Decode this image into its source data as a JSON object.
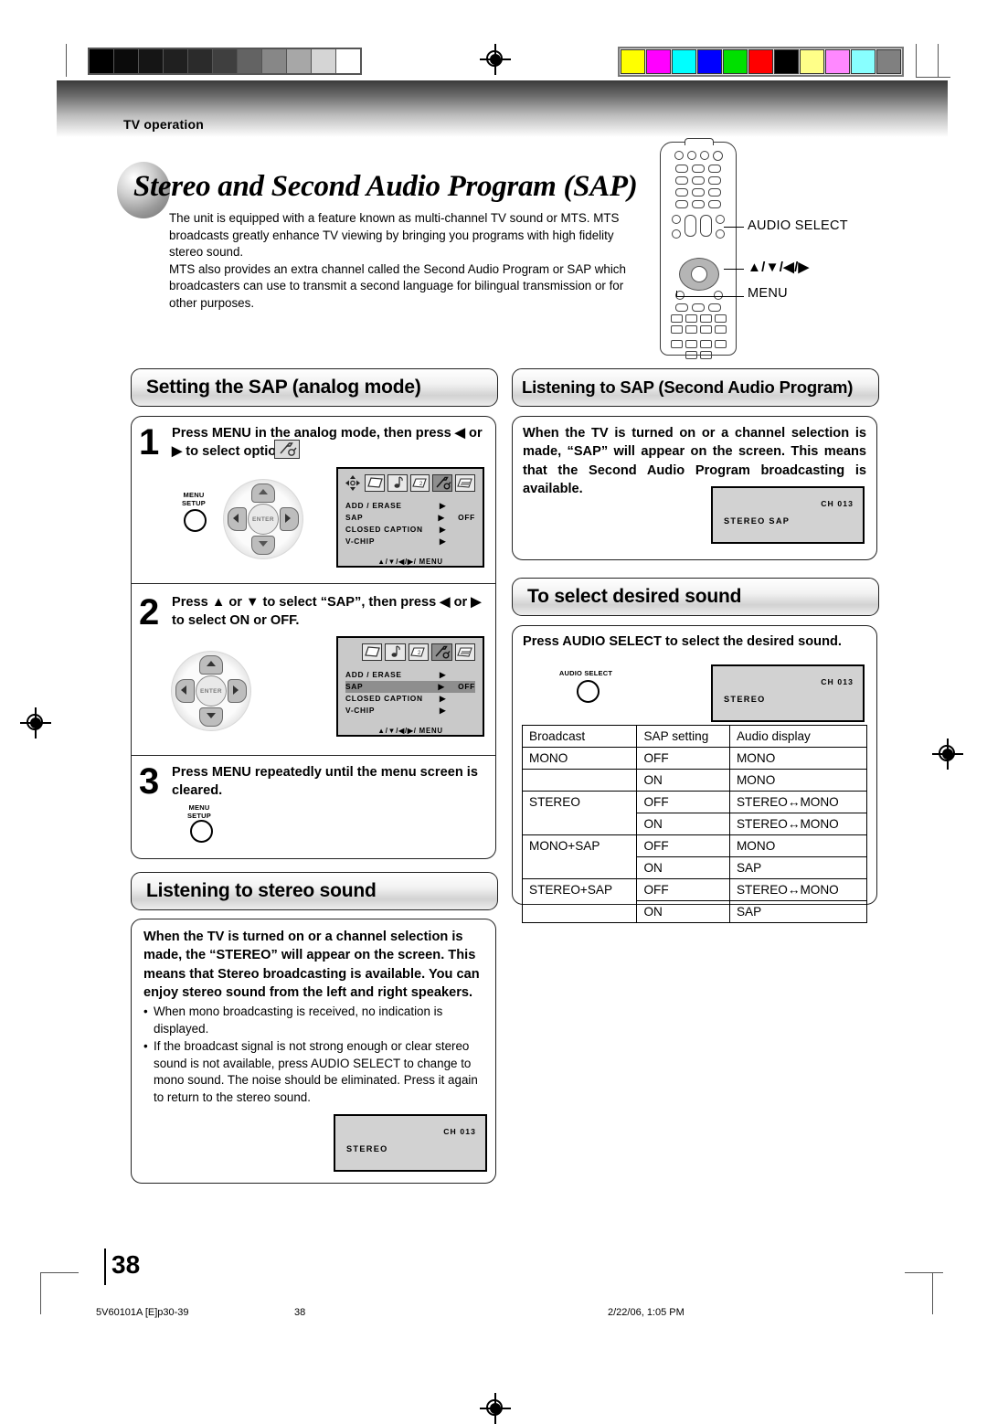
{
  "header": {
    "section_label": "TV operation"
  },
  "title": "Stereo and Second Audio Program (SAP)",
  "intro": "The unit is equipped with a feature known as multi-channel TV sound or MTS. MTS broadcasts greatly enhance TV viewing by bringing you programs with high fidelity stereo sound.\nMTS also provides an extra channel called the Second Audio Program or SAP which broadcasters can use to transmit a second language for bilingual transmission or for other purposes.",
  "remote_callouts": {
    "audio_select": "AUDIO SELECT",
    "arrows": "▲/▼/◀/▶",
    "menu": "MENU"
  },
  "sections": {
    "setting_sap": {
      "heading": "Setting the SAP (analog mode)",
      "steps": [
        {
          "num": "1",
          "text": "Press MENU in the analog mode, then press ◀ or ▶ to select         option."
        },
        {
          "num": "2",
          "text": "Press ▲ or ▼ to select “SAP”, then press ◀ or ▶ to select ON or OFF."
        },
        {
          "num": "3",
          "text": "Press MENU repeatedly until the menu screen is cleared."
        }
      ],
      "button_menu_setup_line1": "MENU",
      "button_menu_setup_line2": "SETUP"
    },
    "listening_sap": {
      "heading": "Listening to SAP (Second Audio Program)",
      "body": "When the TV is turned on or a channel selection is made, “SAP” will appear on the screen. This means that the Second Audio Program broadcasting is available.",
      "screen": {
        "channel": "CH 013",
        "mode": "STEREO  SAP"
      }
    },
    "select_sound": {
      "heading": "To select desired sound",
      "body": "Press AUDIO SELECT to select the desired sound.",
      "button_label": "AUDIO SELECT",
      "screen": {
        "channel": "CH 013",
        "mode": "STEREO"
      }
    },
    "listening_stereo": {
      "heading": "Listening to stereo sound",
      "body": "When the TV is turned on or a channel selection is made, the “STEREO” will appear on the screen. This means that Stereo broadcasting is available. You can enjoy stereo sound from the left and right speakers.",
      "bullets": [
        "When mono broadcasting is received, no indication is displayed.",
        "If the broadcast signal is not strong enough or clear stereo sound is not available, press AUDIO SELECT to change to mono sound. The noise should be eliminated. Press it again to return to the stereo sound."
      ],
      "screen": {
        "channel": "CH 013",
        "mode": "STEREO"
      }
    }
  },
  "osd_menu": {
    "rows": [
      {
        "label": "ADD / ERASE",
        "arrow": "▶",
        "value": ""
      },
      {
        "label": "SAP",
        "arrow": "▶",
        "value": "OFF"
      },
      {
        "label": "CLOSED CAPTION",
        "arrow": "▶",
        "value": ""
      },
      {
        "label": "V-CHIP",
        "arrow": "▶",
        "value": ""
      }
    ],
    "footer": "▲/▼/◀/▶/ MENU"
  },
  "sound_table": {
    "headers": [
      "Broadcast",
      "SAP setting",
      "Audio display"
    ],
    "rows": [
      [
        "MONO",
        "OFF",
        "MONO"
      ],
      [
        "",
        "ON",
        "MONO"
      ],
      [
        "STEREO",
        "OFF",
        "STEREO↔MONO"
      ],
      [
        "",
        "ON",
        "STEREO↔MONO"
      ],
      [
        "MONO+SAP",
        "OFF",
        "MONO"
      ],
      [
        "",
        "ON",
        "SAP"
      ],
      [
        "STEREO+SAP",
        "OFF",
        "STEREO↔MONO"
      ],
      [
        "",
        "ON",
        "SAP"
      ]
    ]
  },
  "footer": {
    "page_number": "38",
    "file_ref": "5V60101A [E]p30-39",
    "center_page": "38",
    "timestamp": "2/22/06, 1:05 PM"
  },
  "calibration": {
    "gray_steps": [
      "#000000",
      "#0b0b0b",
      "#151515",
      "#202020",
      "#2b2b2b",
      "#3f3f3f",
      "#636363",
      "#878787",
      "#a7a7a7",
      "#d5d5d5",
      "#ffffff"
    ],
    "color_steps": [
      "#ffff00",
      "#ff00ff",
      "#00ffff",
      "#0000ff",
      "#00e000",
      "#ff0000",
      "#000000",
      "#ffff88",
      "#ff88ff",
      "#88ffff",
      "#808080"
    ]
  }
}
